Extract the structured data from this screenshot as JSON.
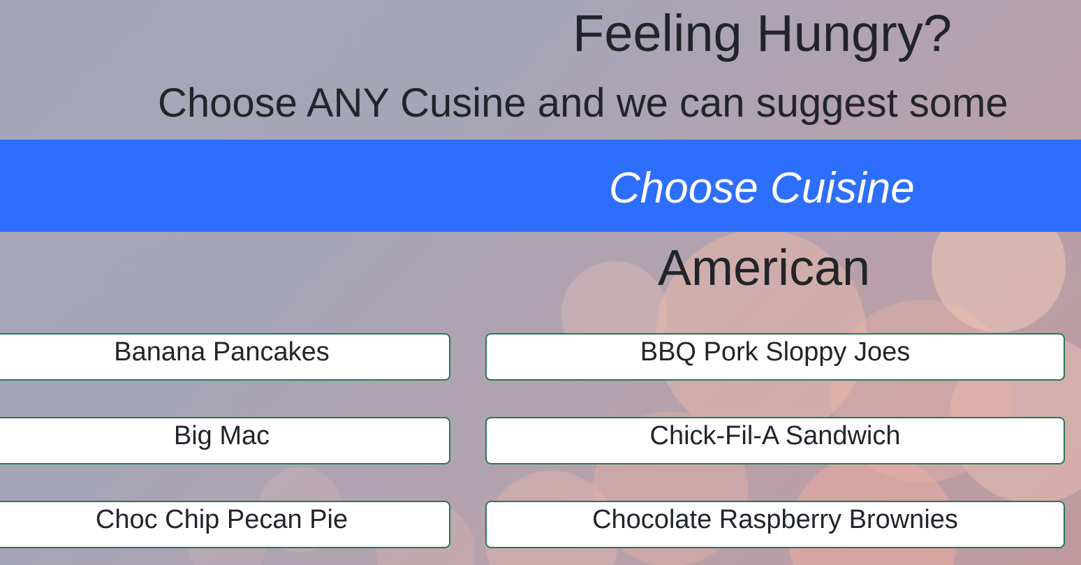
{
  "header": {
    "title": "Feeling Hungry?",
    "subtitle": "Choose ANY Cusine and we can suggest some"
  },
  "cuisine_selector": {
    "label": "Choose Cuisine",
    "background_color": "#2e6efc"
  },
  "selected_cuisine": "American",
  "recipes": {
    "left": [
      "Banana Pancakes",
      "Big Mac",
      "Choc Chip Pecan Pie"
    ],
    "right": [
      "BBQ Pork Sloppy Joes",
      "Chick-Fil-A Sandwich",
      "Chocolate Raspberry Brownies"
    ]
  },
  "colors": {
    "button_border": "#237a54",
    "text": "#212529"
  }
}
